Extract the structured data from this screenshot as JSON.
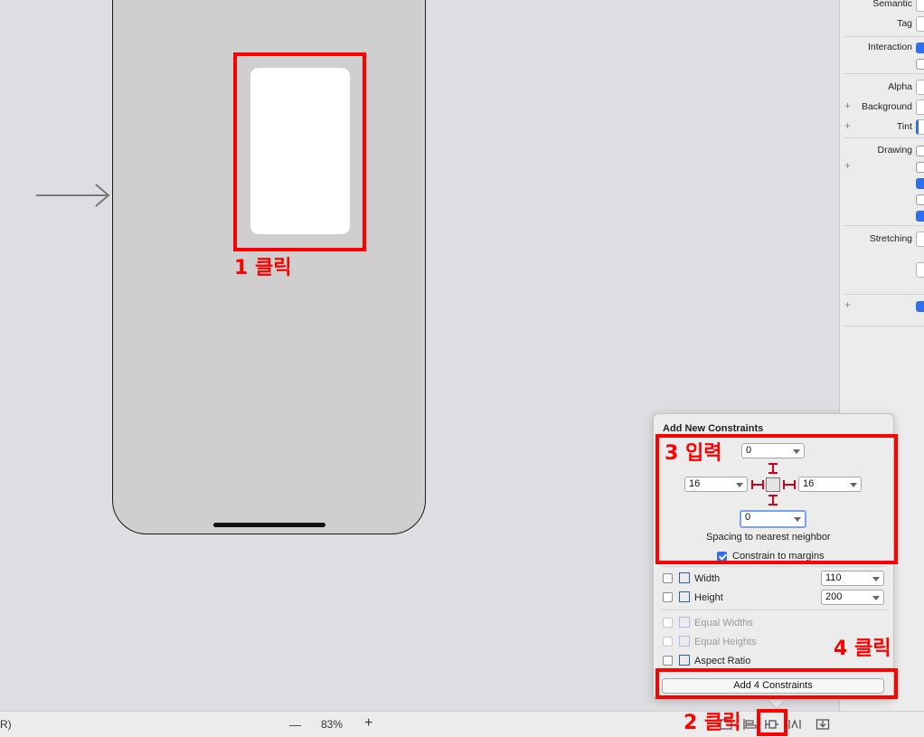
{
  "inspector": {
    "labels": {
      "semantic": "Semantic",
      "tag": "Tag",
      "interaction": "Interaction",
      "alpha": "Alpha",
      "background": "Background",
      "tint": "Tint",
      "drawing": "Drawing",
      "stretching": "Stretching"
    },
    "plus": "+"
  },
  "annotations": {
    "step1": "1 클릭",
    "step2": "2 클릭",
    "step3": "3 입력",
    "step4": "4 클릭"
  },
  "popover": {
    "title": "Add New Constraints",
    "top_value": "0",
    "left_value": "16",
    "right_value": "16",
    "bottom_value": "0",
    "spacing_label": "Spacing to nearest neighbor",
    "constrain_margins_label": "Constrain to margins",
    "constrain_margins_checked": true,
    "width_label": "Width",
    "width_value": "110",
    "height_label": "Height",
    "height_value": "200",
    "equal_widths_label": "Equal Widths",
    "equal_heights_label": "Equal Heights",
    "aspect_ratio_label": "Aspect Ratio",
    "add_button_label": "Add 4 Constraints"
  },
  "bottom_bar": {
    "left_fragment": "R)",
    "zoom_out": "—",
    "zoom_level": "83%",
    "zoom_in": "+"
  },
  "colors": {
    "annotation_red": "#ff0000",
    "accent_blue": "#2e6ff1",
    "strut_red": "#d0021b"
  }
}
